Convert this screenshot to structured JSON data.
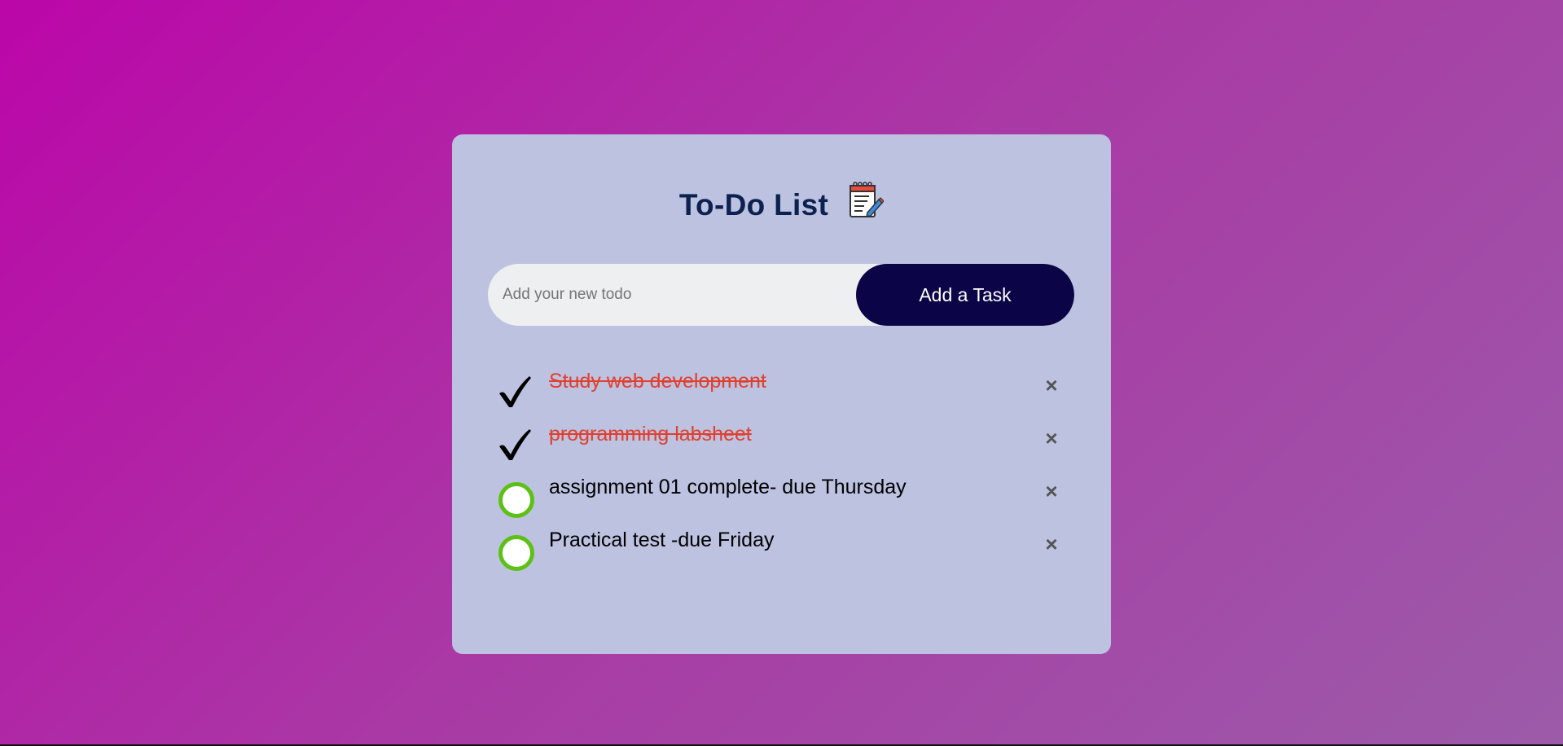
{
  "app": {
    "title": "To-Do List",
    "title_icon": "notepad-pencil-icon"
  },
  "input": {
    "placeholder": "Add your new todo",
    "value": "",
    "add_button_label": "Add a Task"
  },
  "tasks": [
    {
      "text": "Study web development",
      "done": true
    },
    {
      "text": "programming labsheet",
      "done": true
    },
    {
      "text": "assignment 01 complete- due Thursday",
      "done": false
    },
    {
      "text": "Practical test -due Friday",
      "done": false
    }
  ],
  "delete_label": "×",
  "colors": {
    "background_start": "#bb06a8",
    "background_end": "#9c5ba9",
    "card": "#bcc2e0",
    "title": "#0d2150",
    "button": "#0b0548",
    "done_text": "#e0402f",
    "pending_circle": "#5cc114"
  }
}
